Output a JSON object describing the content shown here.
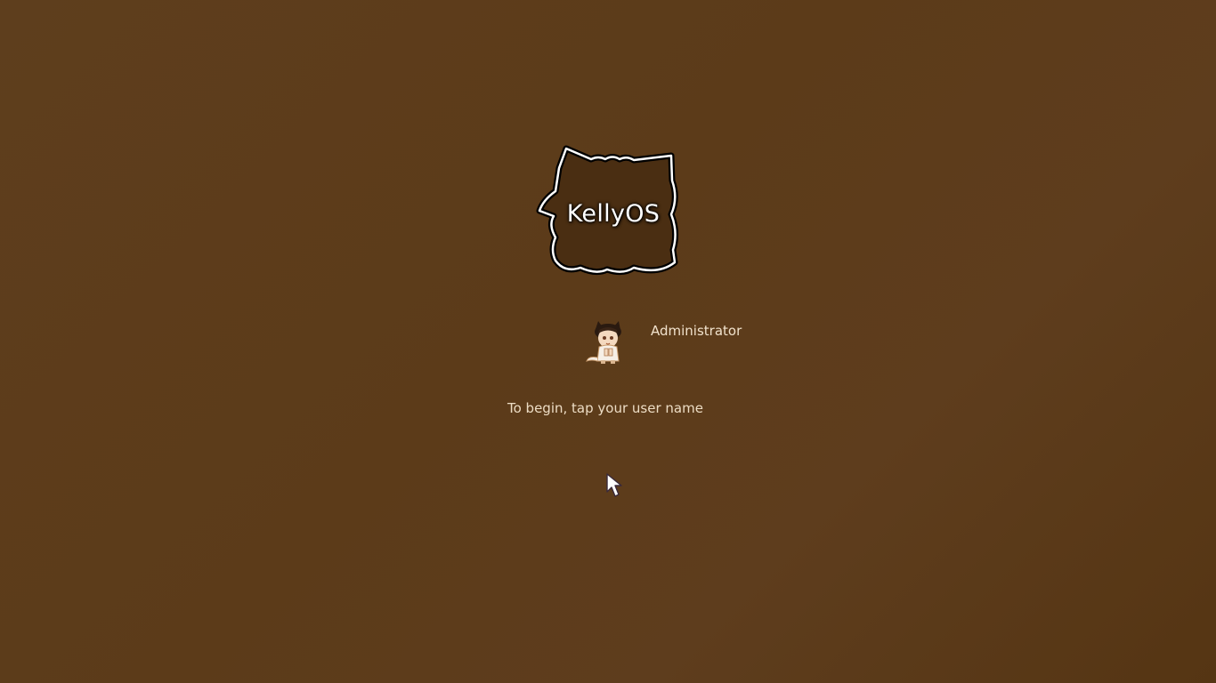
{
  "logo": {
    "text": "KellyOS",
    "icon": "cat-head-outline"
  },
  "user": {
    "name": "Administrator",
    "avatar_icon": "cat-girl-avatar-icon"
  },
  "hint": "To begin, tap your user name",
  "cursor_icon": "mouse-pointer-icon",
  "colors": {
    "background": "#5c3b19",
    "text": "#f1e2cc",
    "logo_outline": "#ffffff"
  }
}
